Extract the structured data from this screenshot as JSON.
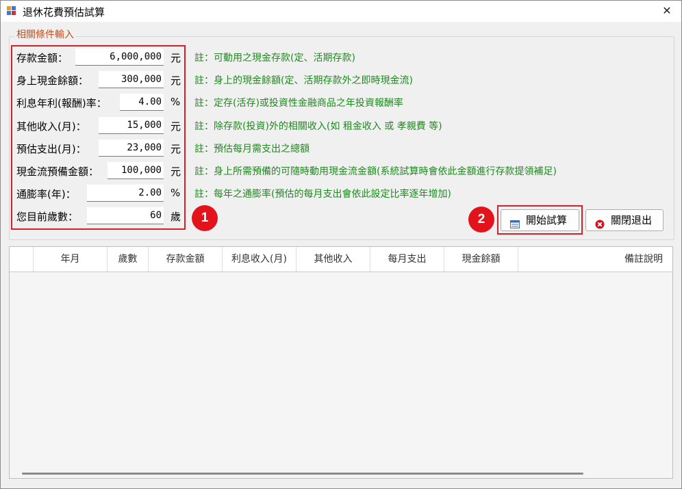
{
  "window": {
    "title": "退休花費預估試算",
    "close_label": "✕"
  },
  "group": {
    "title": "相關條件輸入"
  },
  "fields": [
    {
      "label": "存款金額：",
      "value": "6,000,000",
      "unit": "元",
      "note": "註：可動用之現金存款(定、活期存款)"
    },
    {
      "label": "身上現金餘額：",
      "value": "300,000",
      "unit": "元",
      "note": "註：身上的現金餘額(定、活期存款外之即時現金流)"
    },
    {
      "label": "利息年利(報酬)率：",
      "value": "4.00",
      "unit": "%",
      "note": "註：定存(活存)或投資性金融商品之年投資報酬率"
    },
    {
      "label": "其他收入(月)：",
      "value": "15,000",
      "unit": "元",
      "note": "註：除存款(投資)外的相關收入(如 租金收入 或 孝親費 等)"
    },
    {
      "label": "預估支出(月)：",
      "value": "23,000",
      "unit": "元",
      "note": "註：預估每月需支出之總額"
    },
    {
      "label": "現金流預備金額：",
      "value": "100,000",
      "unit": "元",
      "note": "註：身上所需預備的可隨時動用現金流金額(系統試算時會依此金額進行存款提領補足)"
    },
    {
      "label": "通膨率(年)：",
      "value": "2.00",
      "unit": "%",
      "note": "註：每年之通膨率(預估的每月支出會依此設定比率逐年增加)"
    },
    {
      "label": "您目前歲數：",
      "value": "60",
      "unit": "歲",
      "note": ""
    }
  ],
  "badges": {
    "one": "1",
    "two": "2"
  },
  "buttons": {
    "start": "開始試算",
    "exit": "關閉退出"
  },
  "icons": {
    "start": "table-icon",
    "exit": "close-circle-icon"
  },
  "colors": {
    "highlight": "#d81e28",
    "note": "#1e8a1e",
    "group_title": "#c0501e",
    "exit_icon": "#d0161d"
  },
  "grid": {
    "columns": [
      "",
      "年月",
      "歲數",
      "存款金額",
      "利息收入(月)",
      "其他收入",
      "每月支出",
      "現金餘額",
      "備註說明"
    ],
    "rows": []
  }
}
